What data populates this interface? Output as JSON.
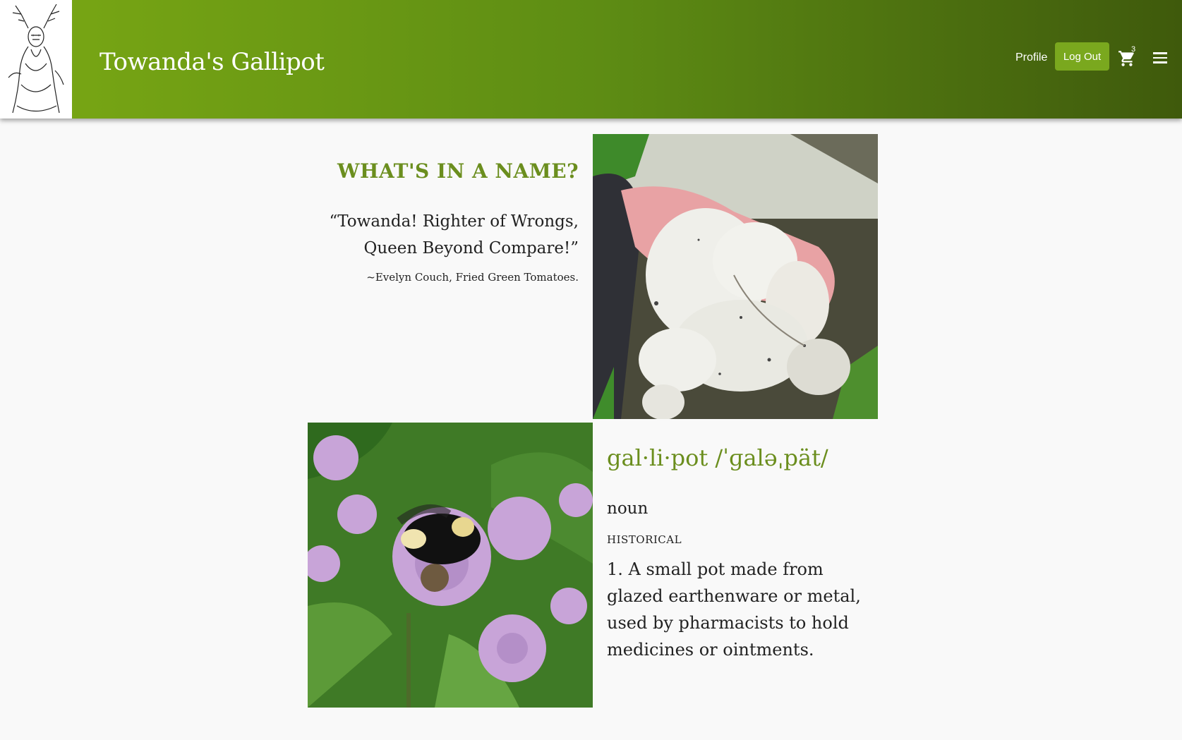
{
  "header": {
    "brand": "Towanda's Gallipot",
    "nav": {
      "profile": "Profile",
      "logout": "Log Out",
      "cart_count": "3"
    },
    "colors": {
      "gradient_start": "#7aa814",
      "gradient_end": "#3f5a0c",
      "button": "#7aa81e"
    }
  },
  "about": {
    "heading": "WHAT'S IN A NAME?",
    "quote_line1": "“Towanda! Righter of Wrongs,",
    "quote_line2": "Queen Beyond Compare!”",
    "citation": "~Evelyn Couch, Fried Green Tomatoes."
  },
  "definition": {
    "word": "gal·li·pot /ˈɡaləˌpät/",
    "part_of_speech": "noun",
    "label": "HISTORICAL",
    "text": "1. A small pot made from glazed earthenware or metal, used by pharmacists to hold medicines or ointments."
  },
  "icons": {
    "logo": "antlered-figure-logo-icon",
    "cart": "shopping-cart-icon",
    "menu": "hamburger-menu-icon"
  },
  "accent_color": "#6b8e1e"
}
